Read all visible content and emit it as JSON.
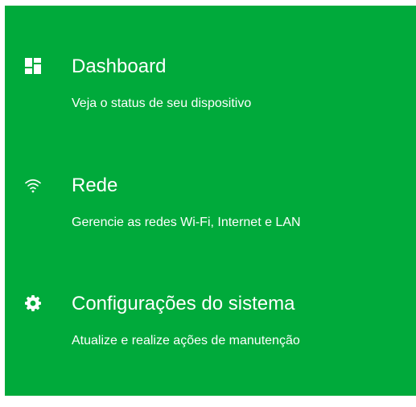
{
  "menu": {
    "items": [
      {
        "title": "Dashboard",
        "description": "Veja o status de seu dispositivo",
        "icon": "dashboard-icon"
      },
      {
        "title": "Rede",
        "description": "Gerencie as redes Wi-Fi, Internet e LAN",
        "icon": "wifi-icon"
      },
      {
        "title": "Configurações do sistema",
        "description": "Atualize e realize ações de manutenção",
        "icon": "gear-icon"
      }
    ]
  },
  "colors": {
    "background": "#00aa3b",
    "text": "#ffffff"
  }
}
